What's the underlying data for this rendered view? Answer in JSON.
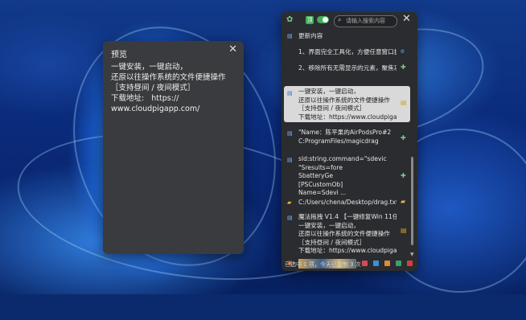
{
  "preview": {
    "title": "预览",
    "close_glyph": "✕",
    "body": "一键安装，一键启动，\n还原以往操作系统的文件便捷操作\n［支持昼间 / 夜间模式］\n下载地址:   https://\nwww.cloudpigapp.com/"
  },
  "panel": {
    "search_placeholder": "请输入搜索内容",
    "close_glyph": "✕",
    "toggle_badge": "顶",
    "items": [
      {
        "text": "更新内容",
        "icon": "text-doc-icon",
        "trail": ""
      },
      {
        "text": "1、界面完全工具化，方便任意窗口执",
        "icon": "",
        "trail": "e"
      },
      {
        "text": "2、移除所有无需显示的元素，聚焦功",
        "icon": "",
        "trail": "✚"
      },
      {
        "text": "一键安装，一键启动，\n还原以往操作系统的文件便捷操作\n［支持昼间 / 夜间模式］\n下载地址：https://www.cloudpigapp",
        "icon": "text-doc-icon",
        "trail": "▤"
      },
      {
        "text": "\"Name：陈平果的AirPodsPro#2\nC:ProgramFiles/magicdrag",
        "icon": "text-doc-icon",
        "trail": "✚"
      },
      {
        "text": "sld:string.command=\"sdevic\n\"Sresults=fore\nSbatteryGe\n[PSCustomOb]\nName=Sdevi ...",
        "icon": "text-doc-icon",
        "trail": "✚"
      },
      {
        "text": "C:/Users/chena/Desktop/drag.txt",
        "icon": "folder-icon",
        "trail": "▰"
      },
      {
        "text": "魔法拖拽 V1.4 【一键修复Win 11任务\n一键安装，一键启动，\n还原以往操作系统的文件便捷操作\n［支持昼间 / 夜间模式］\n下载地址：https://www.cloudpigapp",
        "icon": "text-doc-icon",
        "trail": "▤"
      },
      {
        "text": "",
        "icon": "image-icon",
        "trail": ""
      }
    ],
    "status": "已选中 1 项，今天已复制 3 次"
  },
  "colors": {
    "accent_green": "#3fae5a",
    "footer_icons": [
      "#d44b5a",
      "#3a8fd9",
      "#e08a3a",
      "#3aa06a",
      "#d04040"
    ]
  }
}
